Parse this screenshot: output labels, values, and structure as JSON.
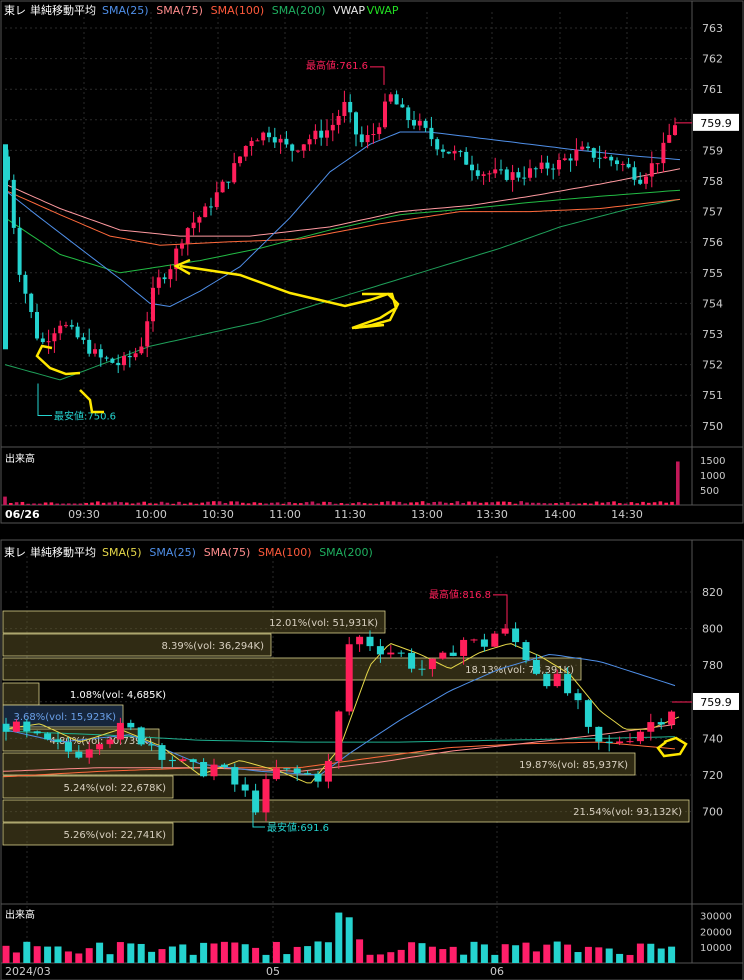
{
  "colors": {
    "up": "#ff1f5a",
    "down": "#25d3cf",
    "grid": "#2a2a2a",
    "sma5": "#e6d84a",
    "sma25": "#3a7bd5",
    "sma75": "#ff8c8c",
    "sma100": "#ff6a3c",
    "sma200": "#1fa05a",
    "vwap": "#e8e8e8",
    "vwap2": "#22dd22",
    "annotation": "#ffe800"
  },
  "top_chart": {
    "ticker": "東レ",
    "indicator_label": "単純移動平均",
    "legend": [
      {
        "label": "SMA(25)",
        "color": "#4f8fe8"
      },
      {
        "label": "SMA(75)",
        "color": "#ff8c8c"
      },
      {
        "label": "SMA(100)",
        "color": "#ff5a3c"
      },
      {
        "label": "SMA(200)",
        "color": "#1fb060"
      },
      {
        "label": "VWAP",
        "color": "#e8e8e8"
      },
      {
        "label": "VWAP",
        "color": "#22dd22"
      }
    ],
    "high_label": "最高値:761.6",
    "low_label": "最安値:750.6",
    "last_price": "759.9",
    "volume_label": "出来高",
    "date_label": "06/26",
    "chart_data": {
      "type": "candlestick",
      "y_ticks": [
        "763",
        "762",
        "761",
        "760",
        "759",
        "758",
        "757",
        "756",
        "755",
        "754",
        "753",
        "752",
        "751",
        "750"
      ],
      "ylim": [
        749.6,
        763.3
      ],
      "x_ticks": [
        "09:30",
        "10:00",
        "10:30",
        "11:00",
        "11:30",
        "13:00",
        "13:30",
        "14:00",
        "14:30"
      ],
      "volume_ticks": [
        "1500",
        "1000",
        "500"
      ],
      "volume_max": 1700,
      "high": 761.6,
      "low": 750.6,
      "last": 759.9
    }
  },
  "bottom_chart": {
    "ticker": "東レ",
    "indicator_label": "単純移動平均",
    "legend": [
      {
        "label": "SMA(5)",
        "color": "#e6d84a"
      },
      {
        "label": "SMA(25)",
        "color": "#4f8fe8"
      },
      {
        "label": "SMA(75)",
        "color": "#ff8c8c"
      },
      {
        "label": "SMA(100)",
        "color": "#ff5a3c"
      },
      {
        "label": "SMA(200)",
        "color": "#1fb060"
      }
    ],
    "high_label": "最高値:816.8",
    "low_label": "最安値:691.6",
    "last_price": "759.9",
    "volume_label": "出来高",
    "date_labels": [
      "2024/03",
      "05",
      "06"
    ],
    "volume_profile": [
      {
        "label": "12.01%(vol: 51,931K)",
        "value": 51931
      },
      {
        "label": "8.39%(vol: 36,294K)",
        "value": 36294
      },
      {
        "label": "18.13%(vol: 78,391K)",
        "value": 78391
      },
      {
        "label": "1.08%(vol: 4,685K)",
        "value": 4685
      },
      {
        "label": "3.68%(vol: 15,923K)",
        "value": 15923
      },
      {
        "label": "4.80%(vol: 20,739K)",
        "value": 20739
      },
      {
        "label": "19.87%(vol: 85,937K)",
        "value": 85937
      },
      {
        "label": "5.24%(vol: 22,678K)",
        "value": 22678
      },
      {
        "label": "21.54%(vol: 93,132K)",
        "value": 93132
      },
      {
        "label": "5.26%(vol: 22,741K)",
        "value": 22741
      }
    ],
    "chart_data": {
      "type": "candlestick",
      "y_ticks": [
        "820",
        "800",
        "780",
        "760",
        "740",
        "720",
        "700"
      ],
      "ylim": [
        690,
        826
      ],
      "volume_ticks": [
        "30000",
        "20000",
        "10000"
      ],
      "volume_max": 33000,
      "high": 816.8,
      "low": 691.6,
      "last": 759.9
    }
  }
}
